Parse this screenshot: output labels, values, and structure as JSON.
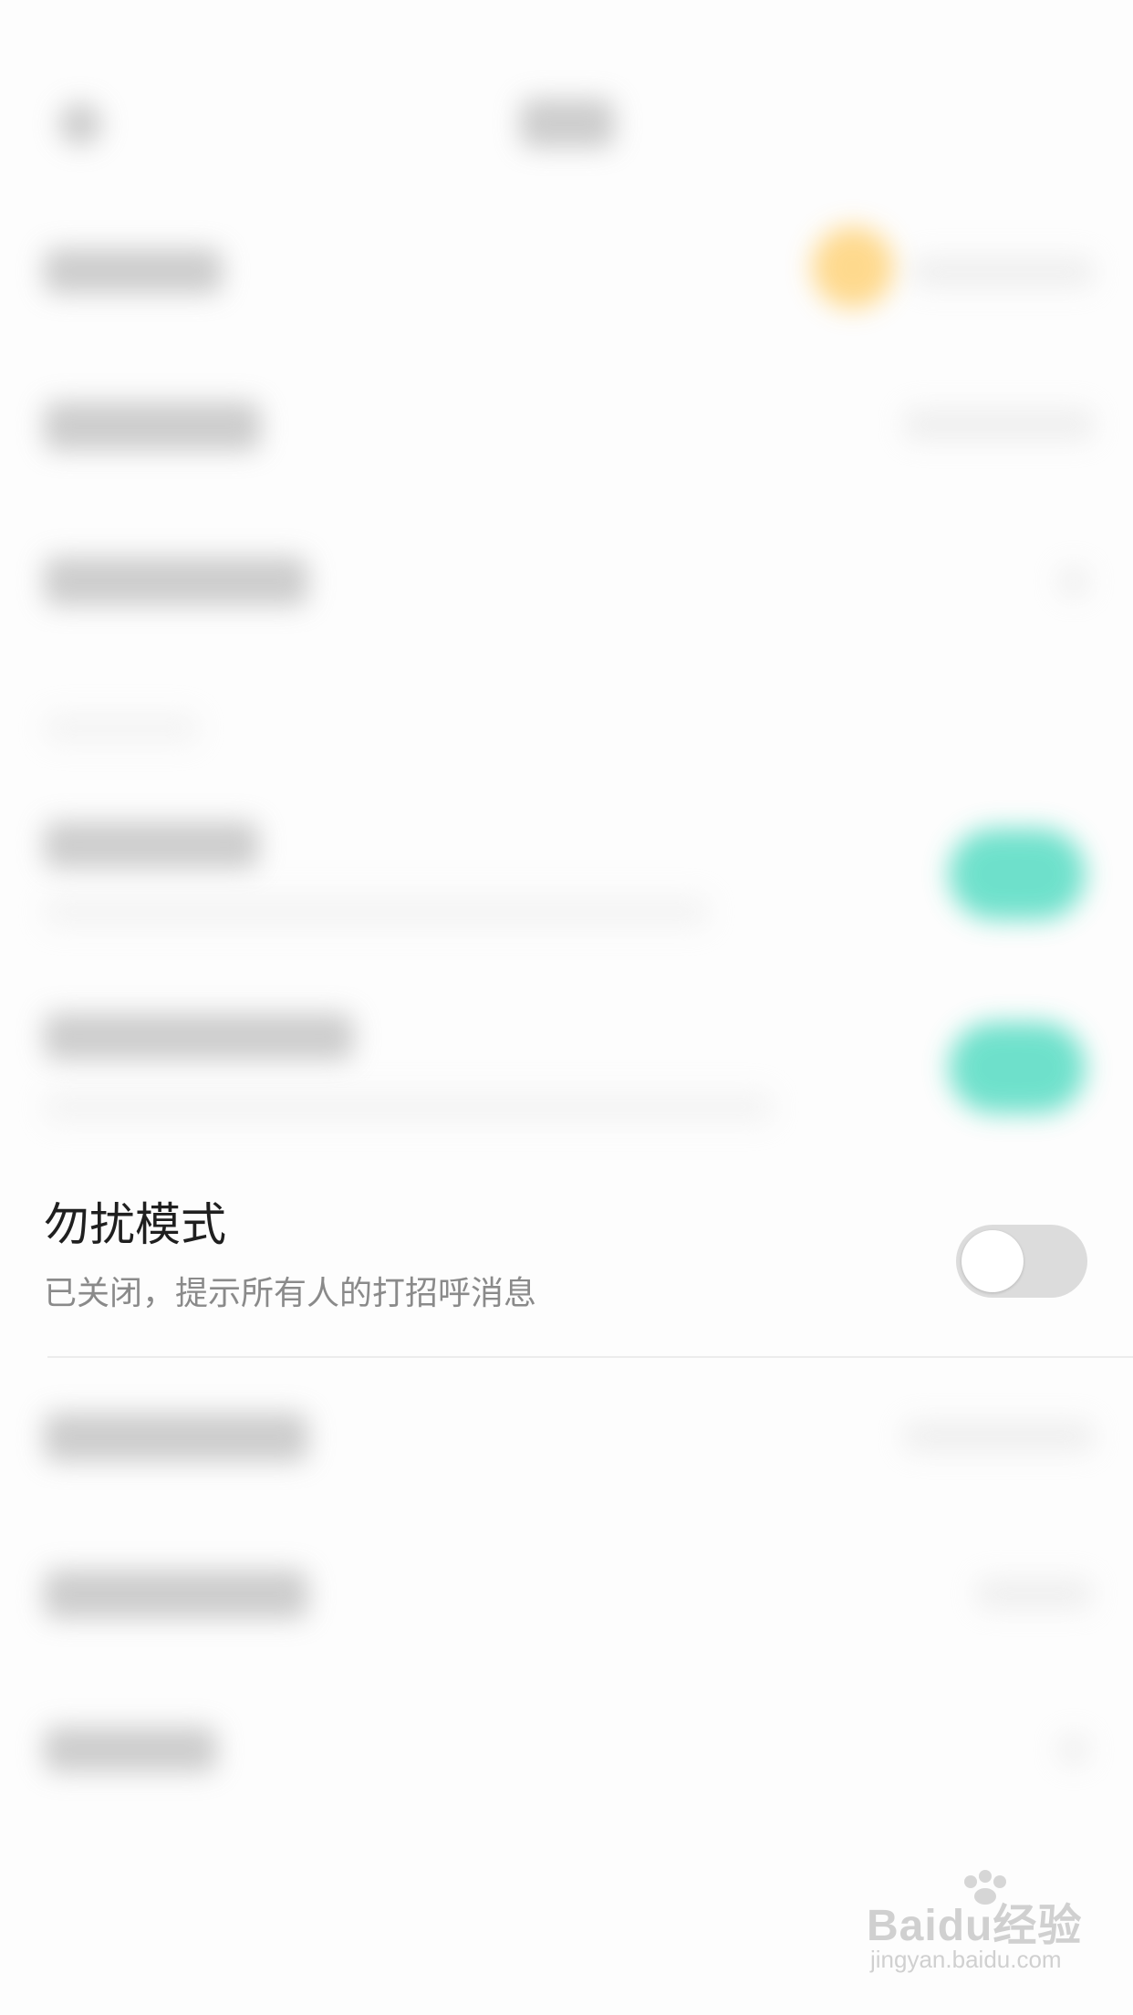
{
  "do_not_disturb": {
    "title": "勿扰模式",
    "status_text": "已关闭，提示所有人的打招呼消息",
    "enabled": false
  },
  "watermark": {
    "brand": "Baidu经验",
    "url": "jingyan.baidu.com"
  },
  "colors": {
    "toggle_off_track": "#dcdcdc",
    "toggle_knob": "#ffffff",
    "accent_teal": "#56dcc3",
    "accent_yellow": "#ffd37a",
    "title_text": "#1f1f1f",
    "subtitle_text": "#8a8a8a"
  }
}
